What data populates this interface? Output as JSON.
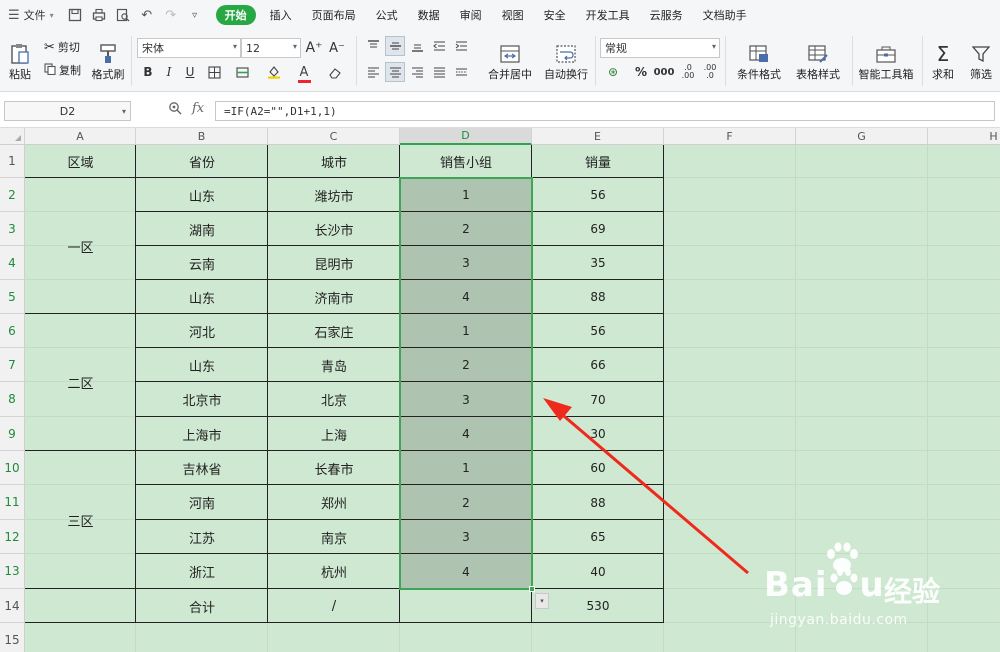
{
  "menu": {
    "file": "文件",
    "tabs": [
      "开始",
      "插入",
      "页面布局",
      "公式",
      "数据",
      "审阅",
      "视图",
      "安全",
      "开发工具",
      "云服务",
      "文档助手"
    ],
    "active_tab": "开始"
  },
  "ribbon": {
    "paste": "粘贴",
    "cut": "剪切",
    "copy": "复制",
    "format_painter": "格式刷",
    "font_name": "宋体",
    "font_size": "12",
    "merge_center": "合并居中",
    "wrap_text": "自动换行",
    "number_format": "常规",
    "conditional_format": "条件格式",
    "table_style": "表格样式",
    "smart_toolbox": "智能工具箱",
    "sum": "求和",
    "filter": "筛选"
  },
  "formula_bar": {
    "name_box": "D2",
    "fx": "fx",
    "formula": "=IF(A2=\"\",D1+1,1)"
  },
  "columns": [
    "A",
    "B",
    "C",
    "D",
    "E",
    "F",
    "G",
    "H"
  ],
  "selected_column": "D",
  "rows": [
    "1",
    "2",
    "3",
    "4",
    "5",
    "6",
    "7",
    "8",
    "9",
    "10",
    "11",
    "12",
    "13",
    "14",
    "15"
  ],
  "table": {
    "headers": [
      "区域",
      "省份",
      "城市",
      "销售小组",
      "销量"
    ],
    "regions": [
      "一区",
      "二区",
      "三区"
    ],
    "data": [
      [
        "山东",
        "潍坊市",
        "1",
        "56"
      ],
      [
        "湖南",
        "长沙市",
        "2",
        "69"
      ],
      [
        "云南",
        "昆明市",
        "3",
        "35"
      ],
      [
        "山东",
        "济南市",
        "4",
        "88"
      ],
      [
        "河北",
        "石家庄",
        "1",
        "56"
      ],
      [
        "山东",
        "青岛",
        "2",
        "66"
      ],
      [
        "北京市",
        "北京",
        "3",
        "70"
      ],
      [
        "上海市",
        "上海",
        "4",
        "30"
      ],
      [
        "吉林省",
        "长春市",
        "1",
        "60"
      ],
      [
        "河南",
        "郑州",
        "2",
        "88"
      ],
      [
        "江苏",
        "南京",
        "3",
        "65"
      ],
      [
        "浙江",
        "杭州",
        "4",
        "40"
      ]
    ],
    "total_label": "合计",
    "total_city": "/",
    "total_sales": "530"
  },
  "watermark": {
    "brand": "Bai",
    "brand_end": "u",
    "brand_cn": "经验",
    "url": "jingyan.baidu.com"
  },
  "colors": {
    "accent": "#28a845",
    "sheet_bg": "#cfe8d1",
    "selection_border": "#3ea556",
    "arrow": "#ee2a1c"
  }
}
